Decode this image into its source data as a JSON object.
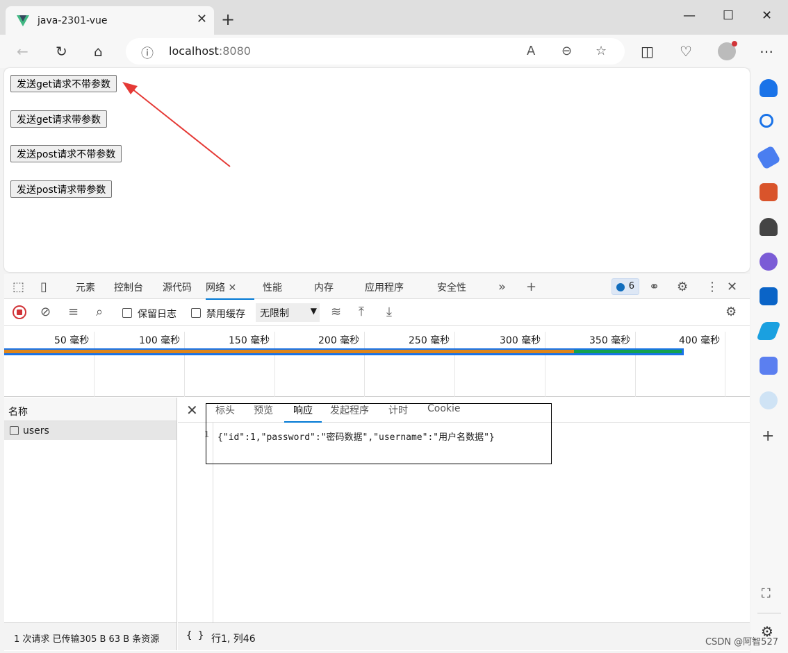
{
  "browser": {
    "tab_title": "java-2301-vue",
    "url_host": "localhost",
    "url_port": ":8080"
  },
  "page": {
    "buttons": [
      "发送get请求不带参数",
      "发送get请求带参数",
      "发送post请求不带参数",
      "发送post请求带参数"
    ]
  },
  "devtools": {
    "tabs": [
      "元素",
      "控制台",
      "源代码",
      "网络",
      "性能",
      "内存",
      "应用程序",
      "安全性"
    ],
    "active_tab": "网络",
    "badge_count": "6",
    "toolbar": {
      "preserve_log": "保留日志",
      "disable_cache": "禁用缓存",
      "throttling": "无限制"
    },
    "timeline_ticks": [
      "50  毫秒",
      "100  毫秒",
      "150  毫秒",
      "200  毫秒",
      "250  毫秒",
      "300  毫秒",
      "350  毫秒",
      "400  毫秒"
    ],
    "name_header": "名称",
    "requests": [
      "users"
    ],
    "detail_tabs": [
      "标头",
      "预览",
      "响应",
      "发起程序",
      "计时",
      "Cookie"
    ],
    "active_detail_tab": "响应",
    "response_line_number": "1",
    "response_body": "{\"id\":1,\"password\":\"密码数据\",\"username\":\"用户名数据\"}",
    "status_summary": "1 次请求  已传输305 B  63 B 条资源",
    "cursor_position": "行1, 列46",
    "format_icon": "{ }"
  },
  "watermark": "CSDN @阿智527",
  "colors": {
    "accent": "#0078d4",
    "annotation_arrow": "#e53935",
    "record": "#d13438"
  }
}
